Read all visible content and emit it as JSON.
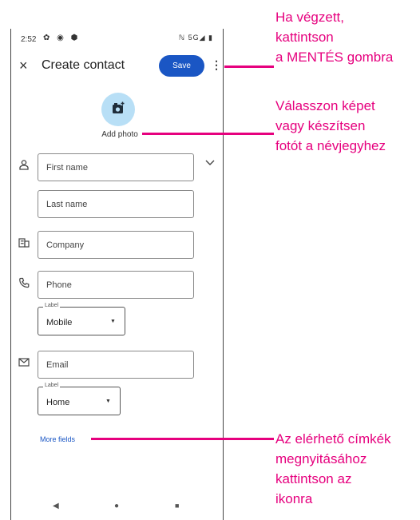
{
  "status_bar": {
    "time": "2:52",
    "left_icons": "✿ ◉ ⬢",
    "right_icons": "ℕ 5G◢ ▮"
  },
  "header": {
    "close": "×",
    "title": "Create contact",
    "save_label": "Save",
    "menu": "⋮"
  },
  "photo": {
    "label": "Add photo",
    "icon": "add-photo-icon"
  },
  "fields": {
    "first_name": "First name",
    "last_name": "Last name",
    "company": "Company",
    "phone": "Phone",
    "email": "Email"
  },
  "phone_label": {
    "caption": "Label",
    "value": "Mobile"
  },
  "email_label": {
    "caption": "Label",
    "value": "Home"
  },
  "more_fields": "More fields",
  "nav": {
    "back": "◀",
    "home": "●",
    "recents": "■"
  },
  "annotations": {
    "save": [
      "Ha végzett,",
      "kattintson",
      "a MENTÉS gombra"
    ],
    "photo": [
      "Válasszon képet",
      "vagy készítsen",
      "fotót a névjegyhez"
    ],
    "more": [
      "Az elérhető címkék",
      "megnyitásához",
      "kattintson az",
      "ikonra"
    ]
  },
  "colors": {
    "accent": "#e6007e",
    "save_button": "#1a56c4",
    "photo_circle": "#b8dff6"
  }
}
